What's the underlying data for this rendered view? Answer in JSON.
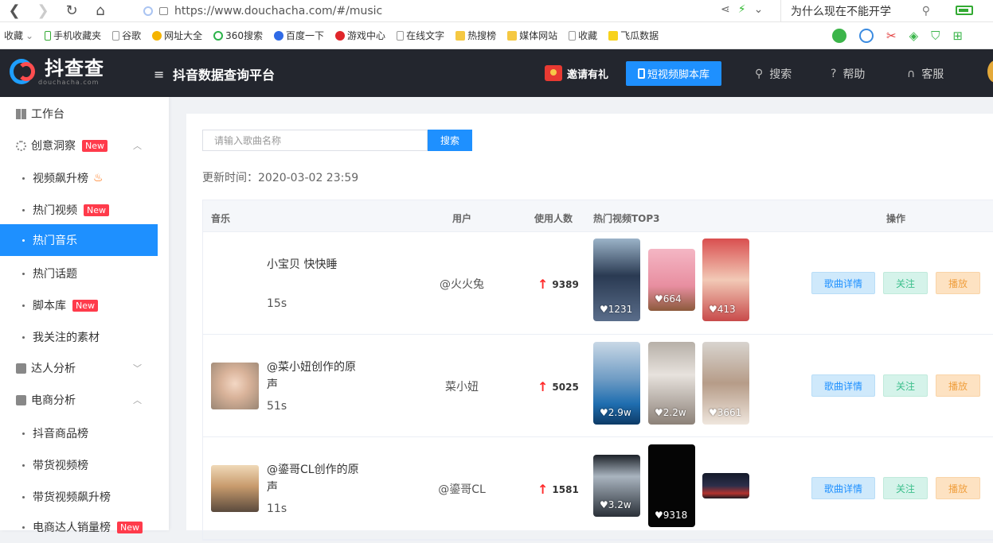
{
  "browser": {
    "url": "https://www.douchacha.com/#/music",
    "search_hint": "为什么现在不能开学"
  },
  "bookmarks": [
    "收藏",
    "手机收藏夹",
    "谷歌",
    "网址大全",
    "360搜索",
    "百度一下",
    "游戏中心",
    "在线文字",
    "热搜榜",
    "媒体网站",
    "收藏",
    "飞瓜数据"
  ],
  "header": {
    "logo_text": "抖查查",
    "logo_sub": "douchacha.com",
    "title": "抖音数据查询平台",
    "invite": "邀请有礼",
    "script_lib": "短视频脚本库",
    "search": "搜索",
    "help": "帮助",
    "service": "客服"
  },
  "sidebar": {
    "workbench": "工作台",
    "creative": "创意洞察",
    "new": "New",
    "items_creative": [
      "视频飙升榜",
      "热门视频",
      "热门音乐",
      "热门话题",
      "脚本库",
      "我关注的素材"
    ],
    "talent": "达人分析",
    "ecommerce": "电商分析",
    "items_ecom": [
      "抖音商品榜",
      "带货视频榜",
      "带货视频飙升榜",
      "电商达人销量榜"
    ]
  },
  "main": {
    "search_placeholder": "请输入歌曲名称",
    "search_btn": "搜索",
    "update_time": "更新时间：2020-03-02 23:59",
    "columns": [
      "音乐",
      "用户",
      "使用人数",
      "热门视频TOP3",
      "操作"
    ],
    "ops": [
      "歌曲详情",
      "关注",
      "播放"
    ],
    "rows": [
      {
        "title": "小宝贝 快快睡",
        "duration": "15s",
        "user": "@火火兔",
        "uses": "9389",
        "likes": [
          "1231",
          "664",
          "413"
        ]
      },
      {
        "title": "@菜小妞创作的原声",
        "duration": "51s",
        "user": "菜小妞",
        "uses": "5025",
        "likes": [
          "2.9w",
          "2.2w",
          "3661"
        ]
      },
      {
        "title": "@鎏哥CL创作的原声",
        "duration": "11s",
        "user": "@鎏哥CL",
        "uses": "1581",
        "likes": [
          "3.2w",
          "9318",
          ""
        ]
      }
    ]
  }
}
